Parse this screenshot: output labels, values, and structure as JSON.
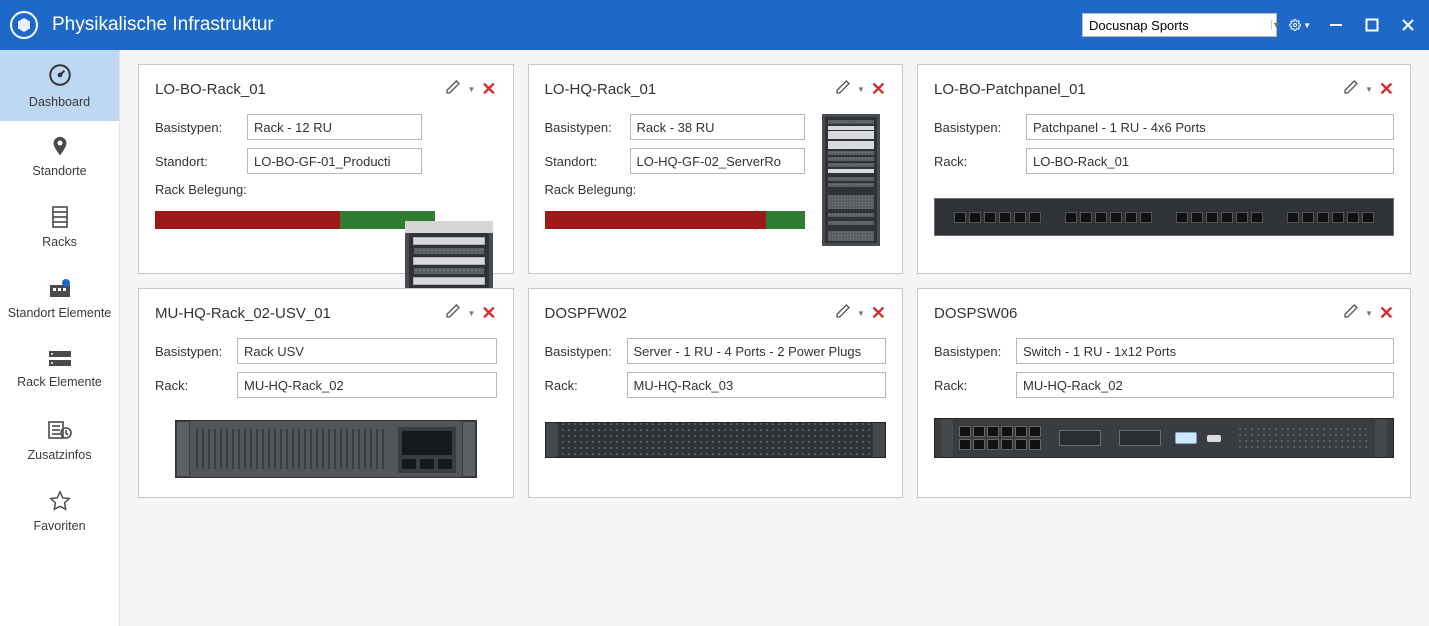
{
  "titlebar": {
    "title": "Physikalische Infrastruktur",
    "selector_value": "Docusnap Sports"
  },
  "nav": {
    "items": [
      {
        "key": "dashboard",
        "label": "Dashboard"
      },
      {
        "key": "standorte",
        "label": "Standorte"
      },
      {
        "key": "racks",
        "label": "Racks"
      },
      {
        "key": "standort-elemente",
        "label": "Standort Elemente"
      },
      {
        "key": "rack-elemente",
        "label": "Rack Elemente"
      },
      {
        "key": "zusatzinfos",
        "label": "Zusatzinfos"
      },
      {
        "key": "favoriten",
        "label": "Favoriten"
      }
    ],
    "active": "dashboard"
  },
  "labels": {
    "basistypen": "Basistypen:",
    "standort": "Standort:",
    "rack": "Rack:",
    "rack_belegung": "Rack Belegung:"
  },
  "cards": [
    {
      "title": "LO-BO-Rack_01",
      "basistypen": "Rack - 12 RU",
      "standort": "LO-BO-GF-01_Producti",
      "usage": {
        "used": 66,
        "free": 34
      }
    },
    {
      "title": "LO-HQ-Rack_01",
      "basistypen": "Rack - 38 RU",
      "standort": "LO-HQ-GF-02_ServerRo",
      "usage": {
        "used": 85,
        "free": 15
      }
    },
    {
      "title": "LO-BO-Patchpanel_01",
      "basistypen": "Patchpanel - 1 RU - 4x6 Ports",
      "rack": "LO-BO-Rack_01"
    },
    {
      "title": "MU-HQ-Rack_02-USV_01",
      "basistypen": "Rack USV",
      "rack": "MU-HQ-Rack_02"
    },
    {
      "title": "DOSPFW02",
      "basistypen": "Server - 1 RU - 4 Ports - 2 Power Plugs",
      "rack": "MU-HQ-Rack_03"
    },
    {
      "title": "DOSPSW06",
      "basistypen": "Switch - 1 RU - 1x12 Ports",
      "rack": "MU-HQ-Rack_02"
    }
  ]
}
